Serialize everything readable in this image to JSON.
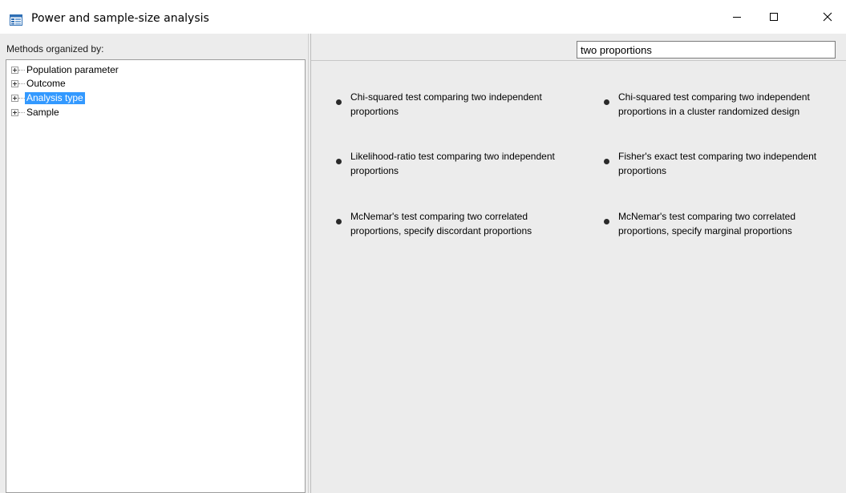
{
  "window": {
    "title": "Power and sample-size analysis",
    "icon": "window-app-icon",
    "controls": [
      "minimize-icon",
      "maximize-icon",
      "close-icon"
    ]
  },
  "left_pane": {
    "header": "Methods organized by:",
    "tree": [
      {
        "label": "Population parameter",
        "expanded": false,
        "selected": false
      },
      {
        "label": "Outcome",
        "expanded": false,
        "selected": false
      },
      {
        "label": "Analysis type",
        "expanded": false,
        "selected": true
      },
      {
        "label": "Sample",
        "expanded": false,
        "selected": false
      }
    ]
  },
  "right_pane": {
    "search": {
      "value": "two proportions"
    },
    "methods": [
      {
        "label": "Chi-squared test comparing two independent proportions"
      },
      {
        "label": "Chi-squared test comparing two independent proportions in a cluster randomized design"
      },
      {
        "label": "Likelihood-ratio test comparing two independent proportions"
      },
      {
        "label": "Fisher's exact test comparing two independent proportions"
      },
      {
        "label": "McNemar's test comparing two correlated proportions, specify discordant proportions"
      },
      {
        "label": "McNemar's test comparing two correlated proportions, specify marginal proportions"
      }
    ]
  },
  "colors": {
    "selection": "#3399ff",
    "pane_background": "#ececec",
    "bullet": "#2a2a2a"
  }
}
